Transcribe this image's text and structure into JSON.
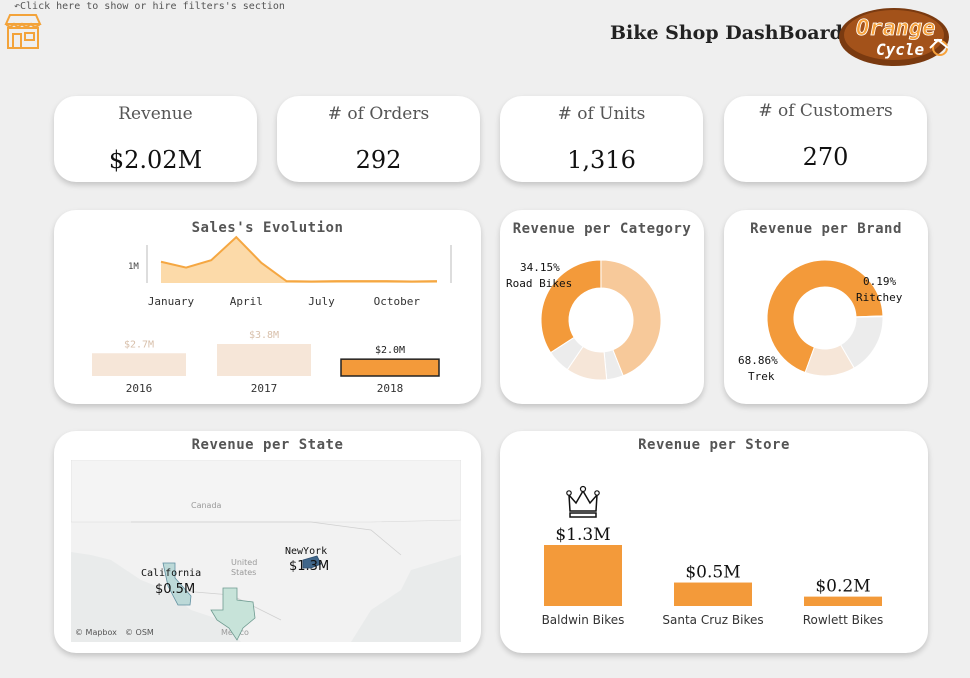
{
  "header": {
    "filter_hint": "↶Click here to show or hire filters's section",
    "title": "Bike Shop DashBoard",
    "logo_line1": "Orange",
    "logo_line2": "Cycle"
  },
  "kpis": [
    {
      "label": "Revenue",
      "value": "$2.02M"
    },
    {
      "label": "# of Orders",
      "value": "292"
    },
    {
      "label": "# of Units",
      "value": "1,316"
    },
    {
      "label": "# of Customers",
      "value": "270"
    }
  ],
  "colors": {
    "accent": "#f39a3a",
    "accent_light": "#f7c99a",
    "pale": "#f6e6d8",
    "grey": "#ececec",
    "area_fill": "#fbd39a",
    "area_line": "#f5a742"
  },
  "chart_data": [
    {
      "id": "sales_evolution",
      "type": "area",
      "title": "Sales's Evolution",
      "x_ticks": [
        "January",
        "April",
        "July",
        "October"
      ],
      "y_ticks": [
        "1M"
      ],
      "x": [
        1,
        2,
        3,
        4,
        5,
        6,
        7,
        8,
        9,
        10,
        11,
        12
      ],
      "values": [
        0.58,
        0.42,
        0.62,
        1.25,
        0.55,
        0.05,
        0.04,
        0.05,
        0.05,
        0.05,
        0.04,
        0.05
      ],
      "ylim": [
        0,
        1.5
      ]
    },
    {
      "id": "sales_by_year",
      "type": "bar",
      "categories": [
        "2016",
        "2017",
        "2018"
      ],
      "values": [
        2.7,
        3.8,
        2.0
      ],
      "labels": [
        "$2.7M",
        "$3.8M",
        "$2.0M"
      ],
      "highlighted": "2018"
    },
    {
      "id": "revenue_per_category",
      "type": "pie",
      "title": "Revenue per Category",
      "slices": [
        {
          "value": 34.15,
          "color": "#f39a3a"
        },
        {
          "value": 44.0,
          "color": "#f7c99a"
        },
        {
          "value": 4.5,
          "color": "#ececec"
        },
        {
          "value": 11.0,
          "color": "#f6e6d8"
        },
        {
          "value": 6.35,
          "color": "#ececec"
        }
      ],
      "annotations": [
        {
          "pct": "34.15%",
          "name": "Road Bikes"
        }
      ]
    },
    {
      "id": "revenue_per_brand",
      "type": "pie",
      "title": "Revenue per Brand",
      "slices": [
        {
          "value": 68.86,
          "color": "#f39a3a"
        },
        {
          "value": 0.19,
          "color": "#ececec"
        },
        {
          "value": 17.0,
          "color": "#ececec"
        },
        {
          "value": 13.95,
          "color": "#f6e6d8"
        }
      ],
      "annotations": [
        {
          "pct": "0.19%",
          "name": "Ritchey"
        },
        {
          "pct": "68.86%",
          "name": "Trek"
        }
      ]
    },
    {
      "id": "revenue_per_store",
      "type": "bar",
      "title": "Revenue per Store",
      "categories": [
        "Baldwin Bikes",
        "Santa Cruz Bikes",
        "Rowlett Bikes"
      ],
      "values": [
        1.3,
        0.5,
        0.2
      ],
      "labels": [
        "$1.3M",
        "$0.5M",
        "$0.2M"
      ]
    }
  ],
  "map": {
    "title": "Revenue per State",
    "states": [
      {
        "name": "California",
        "value": "$0.5M"
      },
      {
        "name": "NewYork",
        "value": "$1.3M"
      }
    ],
    "place_labels": [
      "Canada",
      "United",
      "States",
      "Mexico"
    ],
    "attribution_1": "© Mapbox",
    "attribution_2": "© OSM"
  }
}
